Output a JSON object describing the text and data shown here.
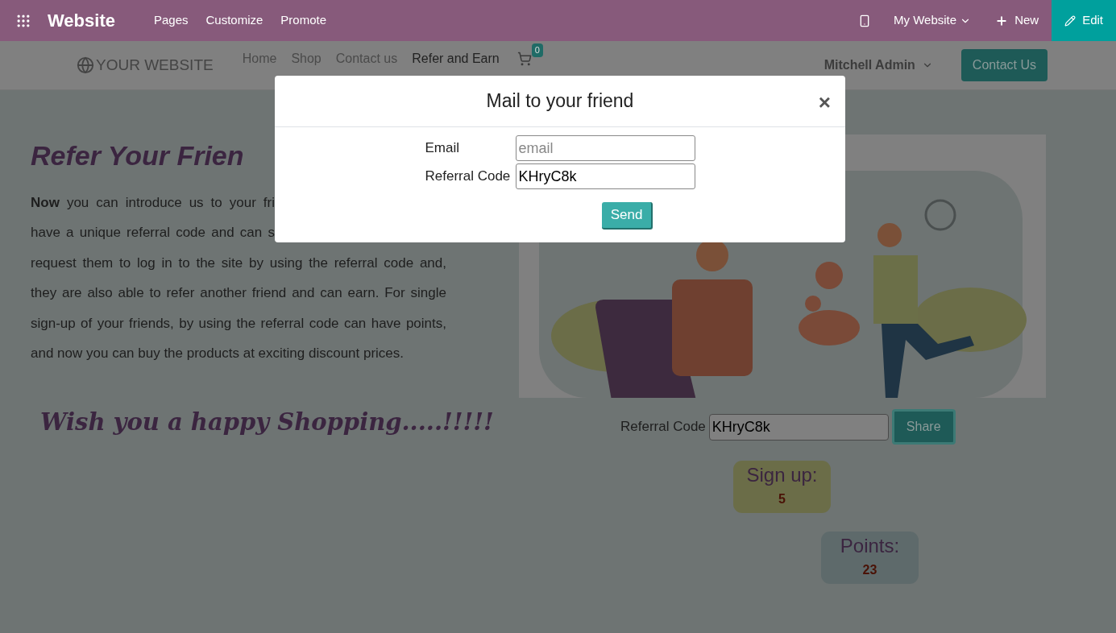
{
  "topbar": {
    "app_title": "Website",
    "menu": [
      "Pages",
      "Customize",
      "Promote"
    ],
    "website_switcher": "My Website",
    "new_button": "New",
    "edit_button": "Edit"
  },
  "site_header": {
    "logo_text": "YOUR WEBSITE",
    "nav": [
      {
        "label": "Home",
        "selected": false
      },
      {
        "label": "Shop",
        "selected": false
      },
      {
        "label": "Contact us",
        "selected": false
      },
      {
        "label": "Refer and Earn",
        "selected": true
      }
    ],
    "cart_count": "0",
    "user": "Mitchell Admin",
    "cta": "Contact Us"
  },
  "content": {
    "heading": "Refer Your Frien",
    "paragraph_lines": [
      "**Now** you can introduce us to your fri",
      "have a unique referral code and can s",
      "request them to log in to the site by using the referral code and,",
      "they are also able to refer another friend and can earn. For single",
      "sign-up of your friends, by using the referral code can have points,",
      "and now you can buy the products at exciting discount prices."
    ],
    "closing": "Wish you a happy Shopping.....!!!!!",
    "referral": {
      "label": "Referral Code",
      "value": "KHryC8k",
      "button": "Share"
    },
    "stats": [
      {
        "label": "Sign up:",
        "value": "5",
        "color": "#6b6d48"
      },
      {
        "label": "Points:",
        "value": "23",
        "color": "#5e6a6b"
      }
    ]
  },
  "dialog": {
    "title": "Mail to your friend",
    "close": "×",
    "fields": [
      {
        "label": "Email",
        "placeholder": "email"
      },
      {
        "label": "Referral Code",
        "value": "KHryC8k"
      }
    ],
    "send_button": "Send"
  }
}
